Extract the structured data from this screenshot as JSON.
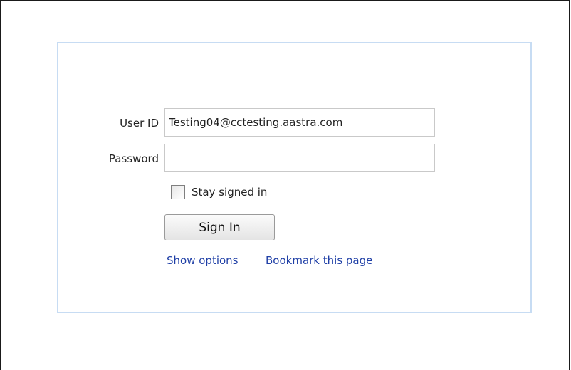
{
  "login": {
    "user_id_label": "User ID",
    "user_id_value": "Testing04@cctesting.aastra.com",
    "password_label": "Password",
    "password_value": "",
    "stay_signed_in_label": "Stay signed in",
    "stay_signed_in_checked": false,
    "sign_in_label": "Sign In",
    "show_options_link": "Show options",
    "bookmark_link": "Bookmark this page"
  },
  "colors": {
    "panel_border": "#c7dcf3",
    "link": "#1f3fa6"
  }
}
